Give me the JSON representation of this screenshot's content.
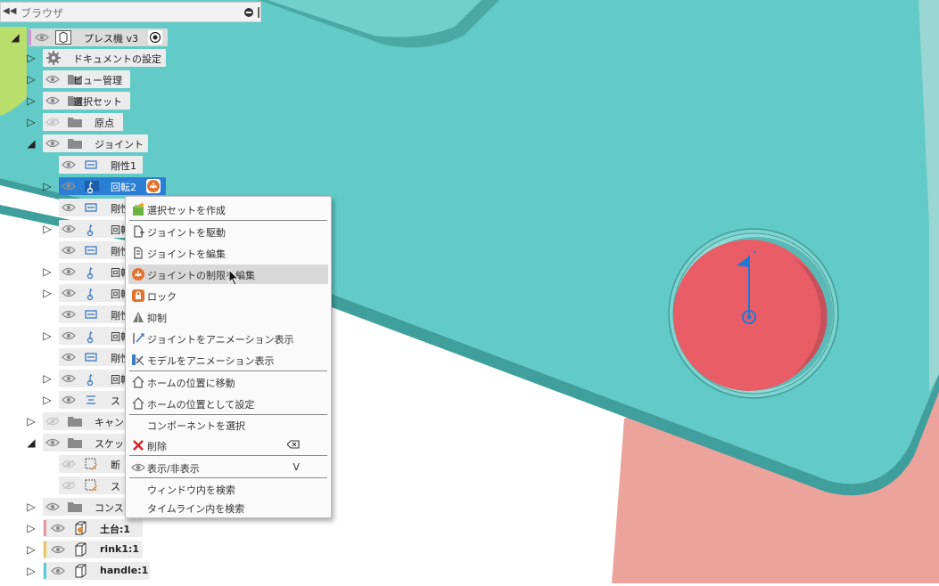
{
  "browser": {
    "title": "ブラウザ",
    "root": {
      "label": "プレス機 v3"
    },
    "items": [
      {
        "label": "ドキュメントの設定"
      },
      {
        "label": "ビュー管理"
      },
      {
        "label": "選択セット"
      },
      {
        "label": "原点"
      },
      {
        "label": "ジョイント"
      },
      {
        "label": "剛性1"
      },
      {
        "label": "回転2"
      },
      {
        "label": "剛性"
      },
      {
        "label": "回転"
      },
      {
        "label": "剛性"
      },
      {
        "label": "回転"
      },
      {
        "label": "回転"
      },
      {
        "label": "剛性"
      },
      {
        "label": "回転"
      },
      {
        "label": "剛性"
      },
      {
        "label": "回転"
      },
      {
        "label": "ス"
      },
      {
        "label": "キャン"
      },
      {
        "label": "スケッ"
      },
      {
        "label": "断"
      },
      {
        "label": "ス"
      },
      {
        "label": "コンス"
      },
      {
        "label": "土台:1"
      },
      {
        "label": "rink1:1"
      },
      {
        "label": "handle:1"
      }
    ]
  },
  "context_menu": {
    "items": [
      {
        "label": "選択セットを作成"
      },
      {
        "label": "ジョイントを駆動"
      },
      {
        "label": "ジョイントを編集"
      },
      {
        "label": "ジョイントの制限を編集"
      },
      {
        "label": "ロック"
      },
      {
        "label": "抑制"
      },
      {
        "label": "ジョイントをアニメーション表示"
      },
      {
        "label": "モデルをアニメーション表示"
      },
      {
        "label": "ホームの位置に移動"
      },
      {
        "label": "ホームの位置として設定"
      },
      {
        "label": "コンポーネントを選択"
      },
      {
        "label": "削除"
      },
      {
        "label": "表示/非表示",
        "shortcut": "V"
      },
      {
        "label": "ウィンドウ内を検索"
      },
      {
        "label": "タイムライン内を検索"
      }
    ]
  },
  "colors": {
    "plate": "#63cbc7",
    "plate_edge": "#3e9e9b",
    "pink_part": "#eba39c",
    "red_disc": "#e85d66",
    "joint_blue": "#1f77d6",
    "selection": "#2a7fd4",
    "menu_highlight": "#d9d9d9"
  }
}
